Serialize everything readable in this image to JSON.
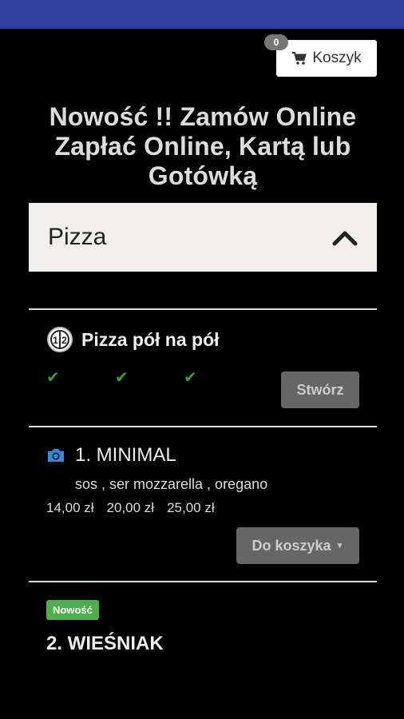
{
  "cart": {
    "count": "0",
    "label": "Koszyk",
    "icon": "shopping-cart-icon"
  },
  "headline": "Nowość !!  Zamów Online Zapłać Online, Kartą lub Gotówką",
  "category": {
    "name": "Pizza",
    "toggle_icon": "chevron-up-icon"
  },
  "half_pizza": {
    "title": "Pizza pół na pół",
    "icon_text": "1 2",
    "create_label": "Stwórz"
  },
  "items": [
    {
      "title": "1. MINIMAL",
      "ingredients": "sos , ser mozzarella , oregano",
      "prices": [
        "14,00 zł",
        "20,00 zł",
        "25,00 zł"
      ],
      "add_label": "Do koszyka"
    },
    {
      "badge": "Nowość",
      "title": "2. WIEŚNIAK"
    }
  ],
  "colors": {
    "statusbar": "#2e3f9e",
    "check": "#3a9a3a",
    "new_badge": "#4cae4c",
    "camera_icon": "#2a8fd6"
  }
}
